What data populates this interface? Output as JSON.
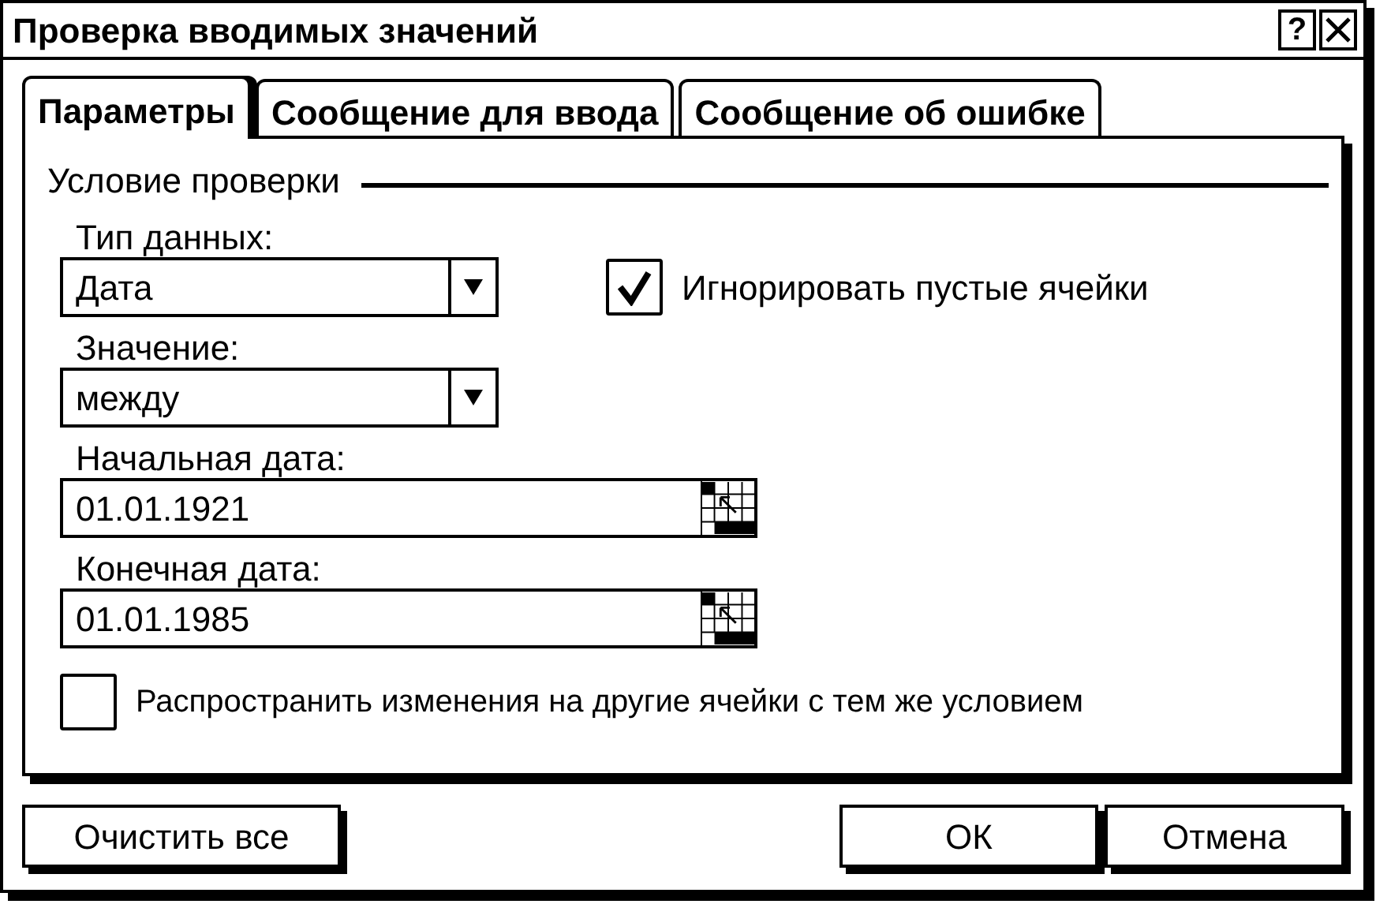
{
  "window": {
    "title": "Проверка вводимых значений",
    "help_button": "?"
  },
  "tabs": [
    {
      "label": "Параметры",
      "selected": true
    },
    {
      "label": "Сообщение для ввода",
      "selected": false
    },
    {
      "label": "Сообщение об ошибке",
      "selected": false
    }
  ],
  "condition": {
    "legend": "Условие проверки",
    "data_type": {
      "label": "Тип данных:",
      "value": "Дата"
    },
    "ignore_blank": {
      "label": "Игнорировать пустые ячейки",
      "checked": true
    },
    "operator": {
      "label": "Значение:",
      "value": "между"
    },
    "start_date": {
      "label": "Начальная дата:",
      "value": "01.01.1921"
    },
    "end_date": {
      "label": "Конечная дата:",
      "value": "01.01.1985"
    }
  },
  "apply_all": {
    "label": "Распространить изменения на другие ячейки с тем же условием",
    "checked": false
  },
  "buttons": [
    {
      "label": "Очистить все",
      "kind": "left"
    },
    {
      "label": "ОК",
      "kind": "right"
    },
    {
      "label": "Отмена",
      "kind": "right"
    }
  ]
}
